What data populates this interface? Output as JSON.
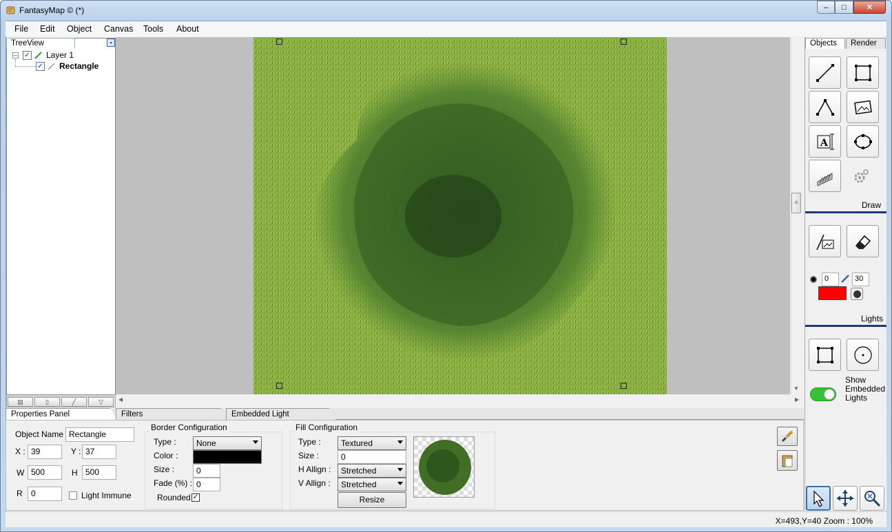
{
  "window": {
    "title": "FantasyMap © (*)",
    "min": "–",
    "max": "□",
    "close": "✕"
  },
  "menu": [
    "File",
    "Edit",
    "Object",
    "Canvas",
    "Tools",
    "About"
  ],
  "treeview": {
    "tab": "TreeView",
    "pin": "▪",
    "expander": "–",
    "check": "✓",
    "layer": "Layer 1",
    "child": "Rectangle",
    "toolbar": [
      "▤",
      "▯",
      "╱",
      "▽"
    ]
  },
  "bottom_tabs": [
    "Properties Panel",
    "Filters",
    "Embedded Light"
  ],
  "properties": {
    "object_name_label": "Object Name",
    "object_name": "Rectangle",
    "x_label": "X :",
    "x": "39",
    "y_label": "Y :",
    "y": "37",
    "w_label": "W",
    "w": "500",
    "h_label": "H",
    "h": "500",
    "r_label": "R",
    "r": "0",
    "light_immune": "Light Immune"
  },
  "border": {
    "title": "Border Configuration",
    "type_label": "Type :",
    "type": "None",
    "color_label": "Color :",
    "color": "#000000",
    "size_label": "Size :",
    "size": "0",
    "fade_label": "Fade (%) :",
    "fade": "0",
    "rounded_label": "Rounded",
    "rounded_check": "✓"
  },
  "fill": {
    "title": "Fill Configuration",
    "type_label": "Type :",
    "type": "Textured",
    "size_label": "Size :",
    "size": "0",
    "halign_label": "H Allign :",
    "halign": "Stretched",
    "valign_label": "V Allign :",
    "valign": "Stretched",
    "resize": "Resize"
  },
  "right_tabs": [
    "Objects",
    "Render"
  ],
  "sections": {
    "draw": "Draw",
    "lights": "Lights"
  },
  "brush": {
    "size": "0",
    "opacity": "30",
    "color": "#ff0000"
  },
  "embedded": {
    "show_label": "Show Embedded Lights",
    "on": true
  },
  "status": "X=493,Y=40  Zoom : 100%",
  "colors": {
    "accent": "#1c3a7a",
    "grass": "#7ea33a",
    "tree": "#3f6e24"
  }
}
